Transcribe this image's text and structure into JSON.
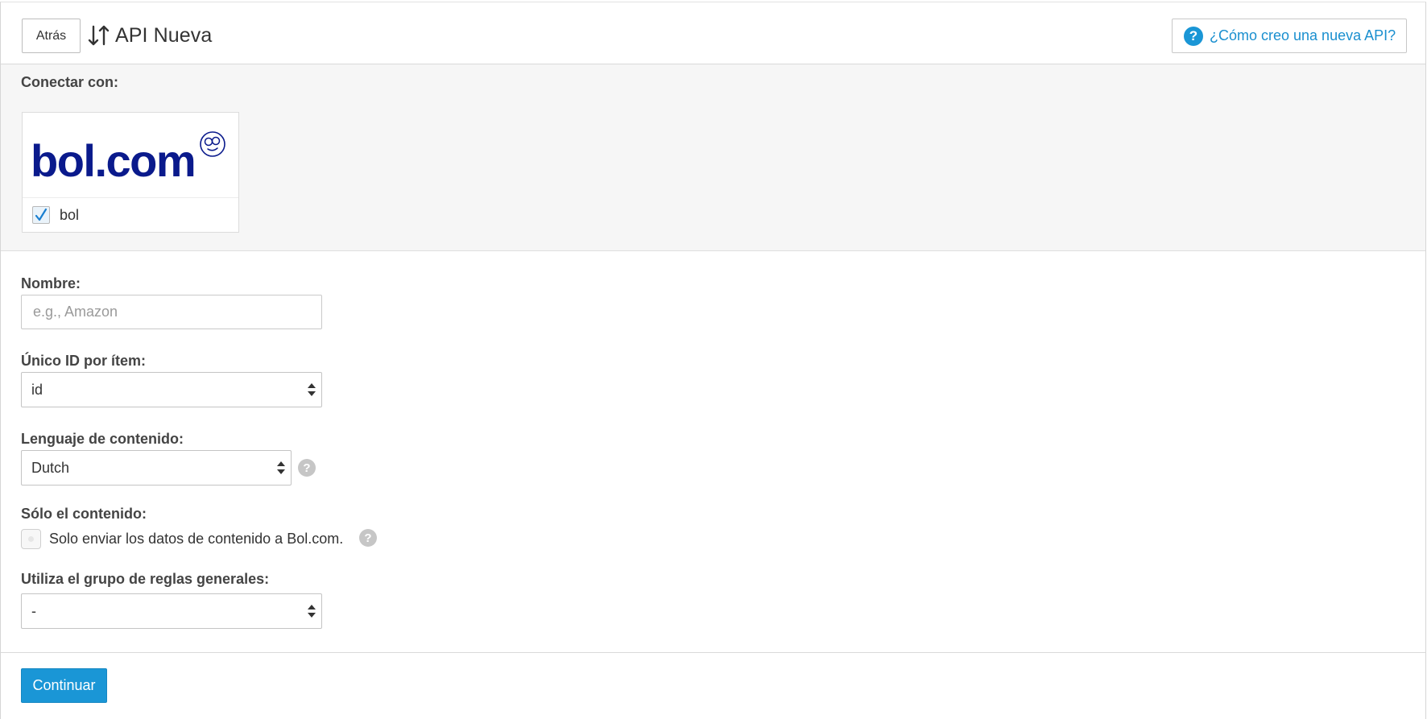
{
  "header": {
    "back_label": "Atrás",
    "title": "API Nueva",
    "help_link_label": "¿Cómo creo una nueva API?"
  },
  "connect": {
    "label": "Conectar con:",
    "options": [
      {
        "logo_text": "bol.com",
        "name": "bol",
        "checked": true
      }
    ]
  },
  "form": {
    "name": {
      "label": "Nombre:",
      "value": "",
      "placeholder": "e.g., Amazon"
    },
    "unique_id": {
      "label": "Único ID por ítem:",
      "selected": "id"
    },
    "content_language": {
      "label": "Lenguaje de contenido:",
      "selected": "Dutch"
    },
    "content_only": {
      "label": "Sólo el contenido:",
      "option_label": "Solo enviar los datos de contenido a Bol.com.",
      "checked": false
    },
    "rule_group": {
      "label": "Utiliza el grupo de reglas generales:",
      "selected": "-"
    }
  },
  "footer": {
    "continue_label": "Continuar"
  },
  "colors": {
    "accent": "#1a96d6",
    "logo": "#0a1a8c",
    "panel_bg": "#f6f6f6"
  },
  "icons": {
    "sort": "sort-arrows-icon",
    "help": "question-circle-icon",
    "caret": "select-caret-icon",
    "check": "checkmark-icon"
  }
}
